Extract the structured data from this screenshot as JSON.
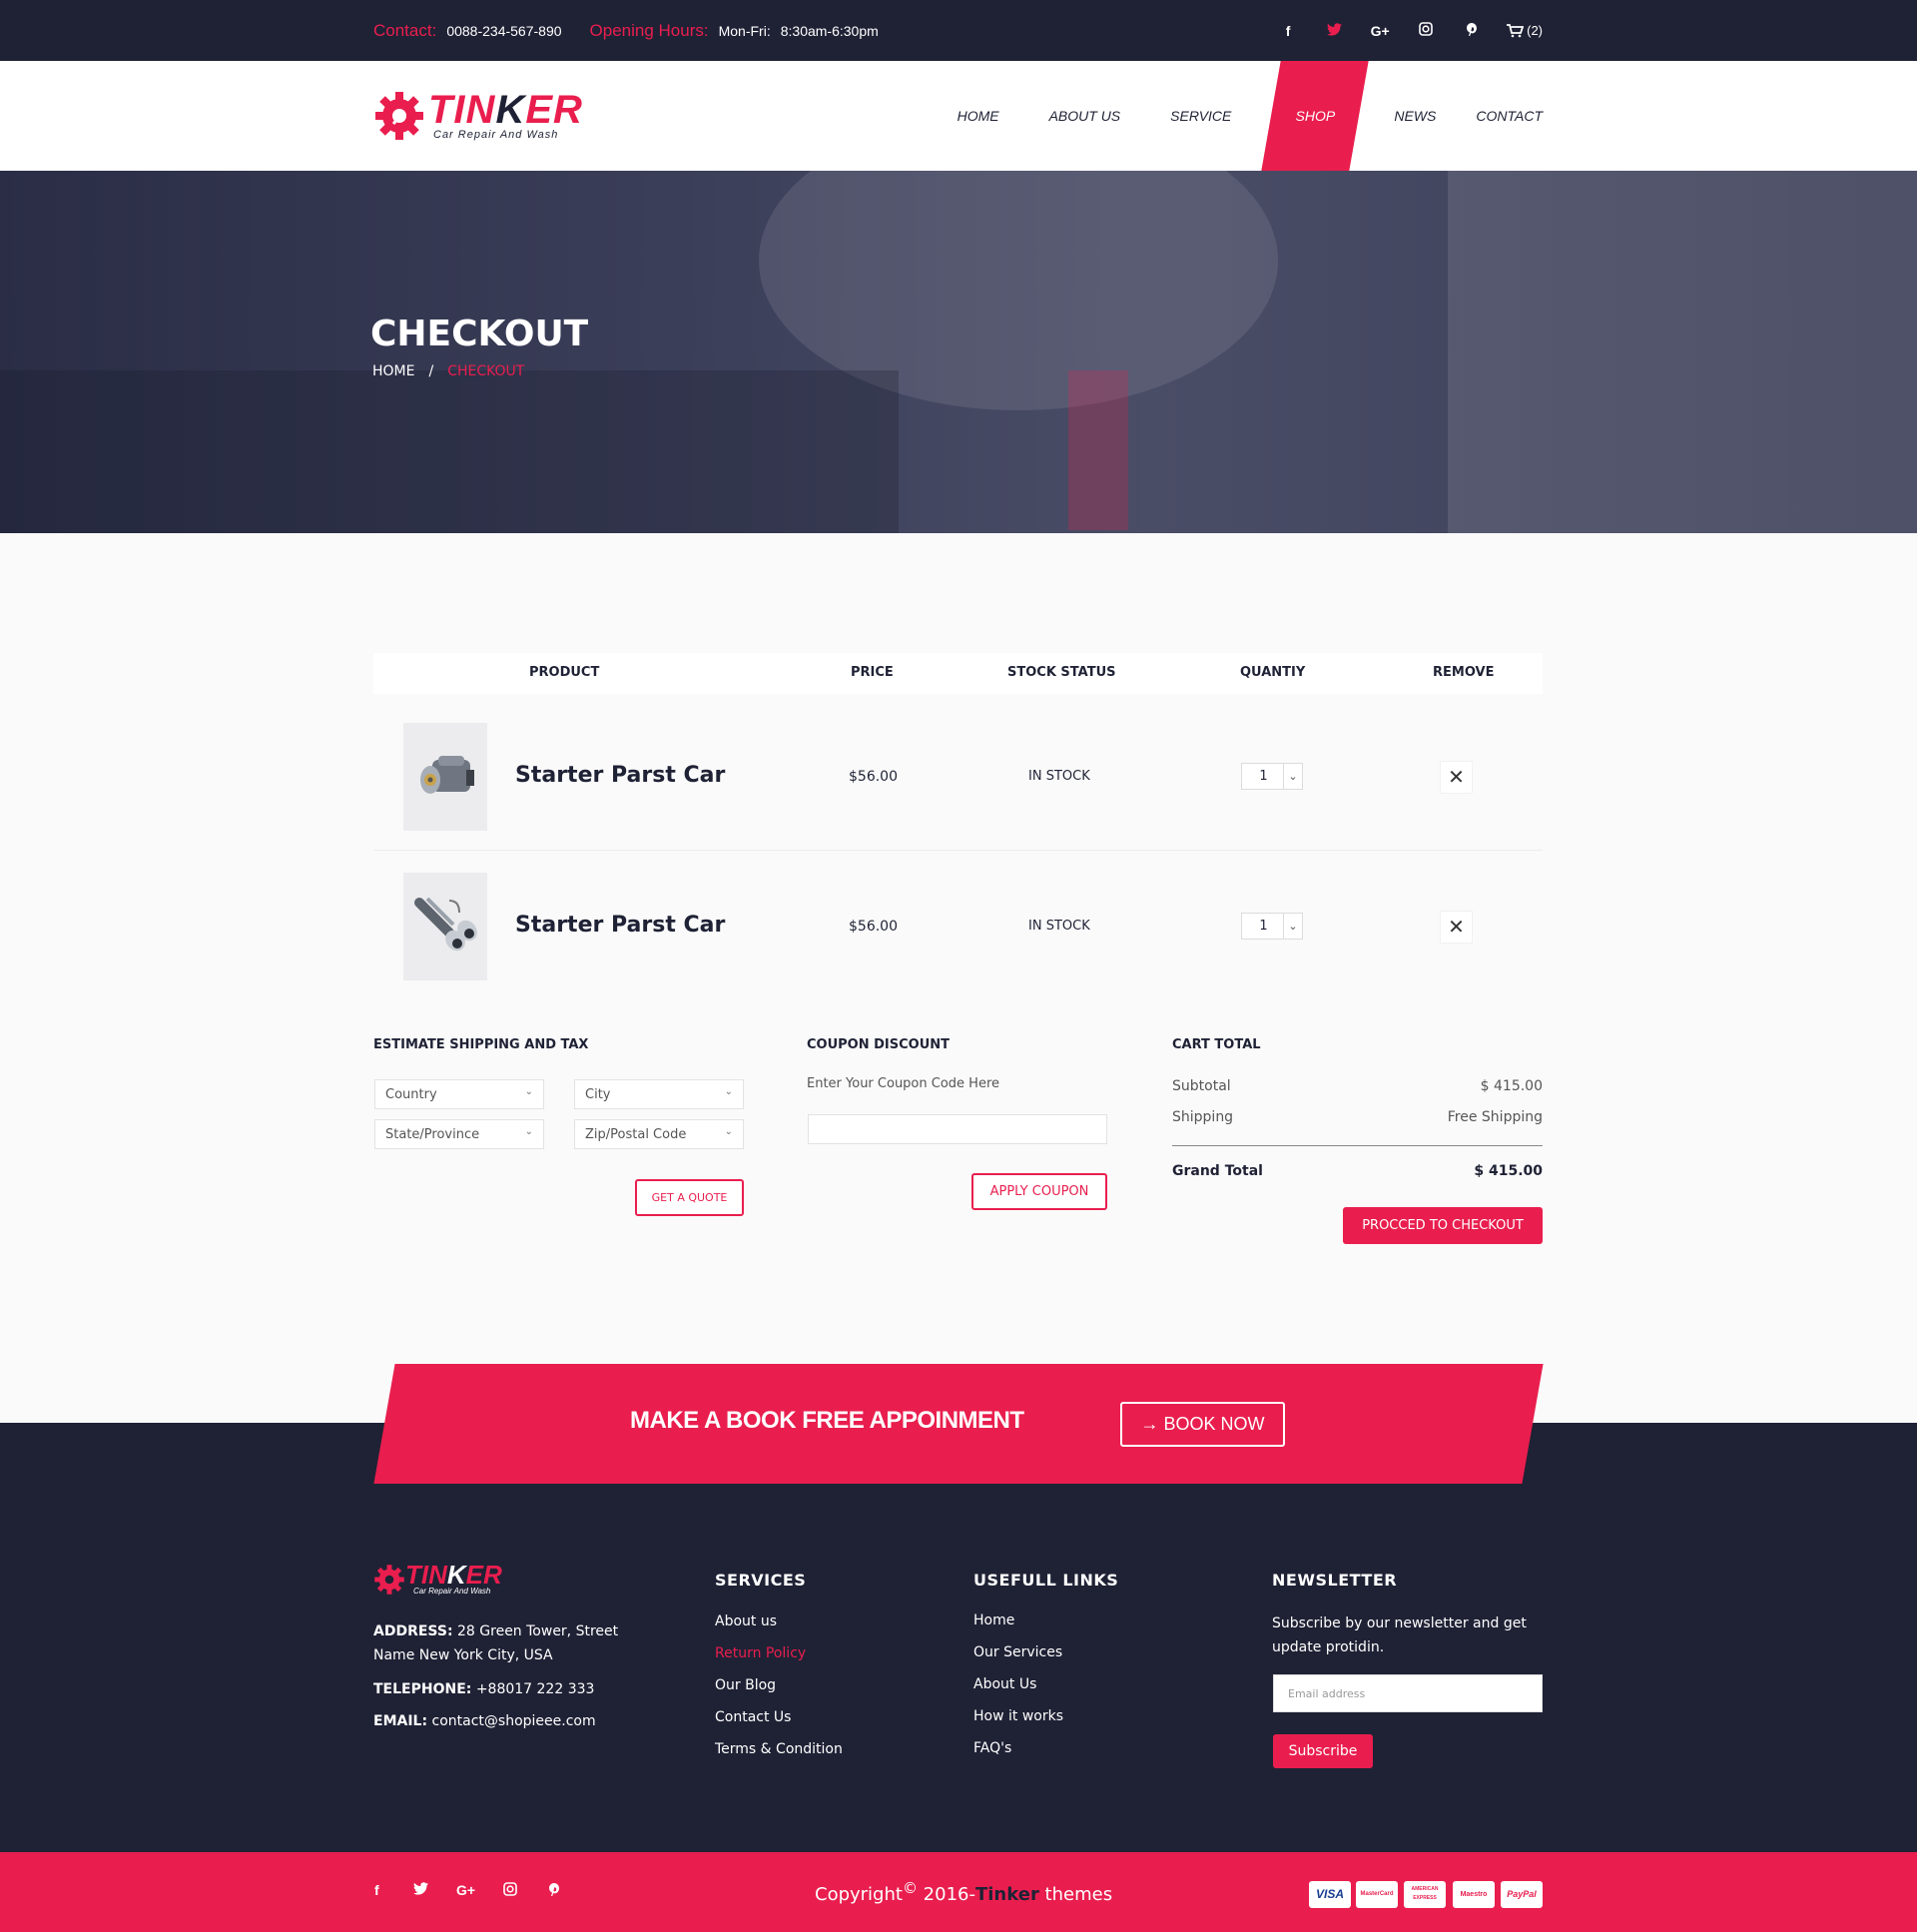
{
  "topbar": {
    "contact_label": "Contact:",
    "contact_value": "0088-234-567-890",
    "hours_label": "Opening Hours:",
    "hours_days": "Mon-Fri:",
    "hours_time": "8:30am-6:30pm",
    "social": [
      "f",
      "t",
      "G+",
      "ig",
      "p"
    ],
    "cart_count": "(2)"
  },
  "brand": {
    "name_first": "TIN",
    "name_k": "K",
    "name_rest": "ER",
    "tagline": "Car Repair And Wash"
  },
  "nav": {
    "items": [
      "HOME",
      "ABOUT US",
      "SERVICE",
      "SHOP",
      "NEWS",
      "CONTACT"
    ],
    "active": "SHOP"
  },
  "hero": {
    "title": "CHECKOUT",
    "crumb_home": "HOME",
    "crumb_sep": "/",
    "crumb_current": "CHECKOUT"
  },
  "cart_table": {
    "headers": {
      "product": "PRODUCT",
      "price": "PRICE",
      "stock": "STOCK STATUS",
      "quantity": "QUANTIY",
      "remove": "REMOVE"
    },
    "rows": [
      {
        "name": "Starter Parst Car",
        "price": "$56.00",
        "stock": "IN STOCK",
        "qty": "1",
        "image_icon": "starter-motor-icon"
      },
      {
        "name": "Starter Parst Car",
        "price": "$56.00",
        "stock": "IN STOCK",
        "qty": "1",
        "image_icon": "exhaust-pipe-icon"
      }
    ]
  },
  "shipping": {
    "title": "ESTIMATE SHIPPING AND TAX",
    "country": "Country",
    "city": "City",
    "state": "State/Province",
    "zip": "Zip/Postal Code",
    "quote_btn": "GET A QUOTE"
  },
  "coupon": {
    "title": "COUPON DISCOUNT",
    "label": "Enter Your Coupon Code  Here",
    "value": "",
    "apply_btn": "APPLY COUPON"
  },
  "totals": {
    "title": "CART TOTAL",
    "subtotal_label": "Subtotal",
    "subtotal": "$ 415.00",
    "shipping_label": "Shipping",
    "shipping": "Free Shipping",
    "grand_label": "Grand Total",
    "grand": "$ 415.00",
    "checkout_btn": "PROCCED TO CHECKOUT"
  },
  "booking": {
    "text": "MAKE A BOOK FREE APPOINMENT",
    "btn": "→ BOOK NOW"
  },
  "footer": {
    "address_label": "ADDRESS:",
    "address": "28 Green Tower, Street",
    "address2": "Name New York City, USA",
    "phone_label": "TELEPHONE:",
    "phone": "+88017 222 333",
    "email_label": "EMAIL:",
    "email": "contact@shopieee.com",
    "services_title": "SERVICES",
    "services": [
      "About us",
      "Return Policy",
      "Our Blog",
      "Contact Us",
      "Terms & Condition"
    ],
    "links_title": "USEFULL LINKS",
    "links": [
      "Home",
      "Our Services",
      "About Us",
      "How it works",
      "FAQ's"
    ],
    "newsletter_title": "NEWSLETTER",
    "newsletter_text": "Subscribe by our newsletter and get",
    "newsletter_text2": "update protidin.",
    "email_placeholder": "Email address",
    "subscribe_btn": "Subscribe"
  },
  "bottombar": {
    "social": [
      "f",
      "t",
      "G+",
      "ig",
      "p"
    ],
    "copy_prefix": "Copyright",
    "copy_symbol": "©",
    "copy_year": " 2016-",
    "copy_brand": "Tinker",
    "copy_suffix": " themes",
    "payments": [
      "VISA",
      "MasterCard",
      "AMERICAN EXPRESS",
      "Maestro",
      "PayPal"
    ]
  },
  "colors": {
    "accent": "#e91e4e",
    "dark": "#1f2235",
    "page_bg": "#fafafa"
  }
}
